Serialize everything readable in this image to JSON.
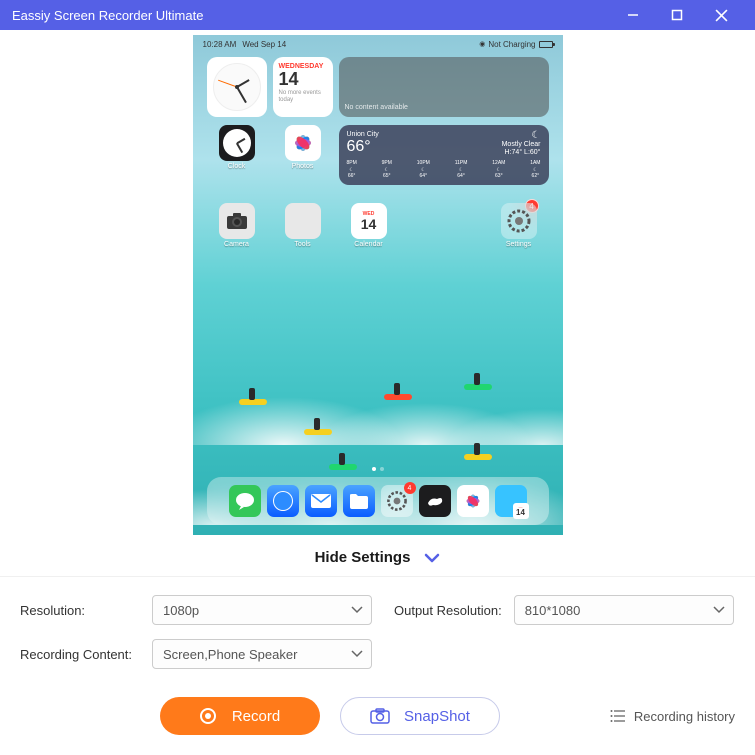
{
  "titlebar": {
    "title": "Eassiy Screen Recorder Ultimate"
  },
  "preview": {
    "status": {
      "time": "10:28 AM",
      "date": "Wed Sep 14",
      "charging": "Not Charging"
    },
    "widgets": {
      "calendar": {
        "wday": "WEDNESDAY",
        "day": "14",
        "note": "No more events today"
      },
      "empty": "No content available"
    },
    "weather": {
      "city": "Union City",
      "temp": "66°",
      "cond": "Mostly Clear",
      "hilo": "H:74° L:60°",
      "hours": [
        {
          "t": "8PM",
          "v": "66°"
        },
        {
          "t": "9PM",
          "v": "65°"
        },
        {
          "t": "10PM",
          "v": "64°"
        },
        {
          "t": "11PM",
          "v": "64°"
        },
        {
          "t": "12AM",
          "v": "63°"
        },
        {
          "t": "1AM",
          "v": "62°"
        }
      ]
    },
    "apps_row2": {
      "clock": "Clock",
      "photos": "Photos"
    },
    "apps_row3": {
      "camera": "Camera",
      "tools": "Tools",
      "calendar": "Calendar",
      "cal_wday": "WED",
      "cal_day": "14",
      "settings": "Settings",
      "settings_badge": "4"
    },
    "dock": {
      "settings_badge": "4"
    }
  },
  "hide_label": "Hide Settings",
  "settings": {
    "resolution_label": "Resolution:",
    "resolution_value": "1080p",
    "output_label": "Output Resolution:",
    "output_value": "810*1080",
    "content_label": "Recording Content:",
    "content_value": "Screen,Phone Speaker"
  },
  "bottom": {
    "record": "Record",
    "snapshot": "SnapShot",
    "history": "Recording history"
  }
}
